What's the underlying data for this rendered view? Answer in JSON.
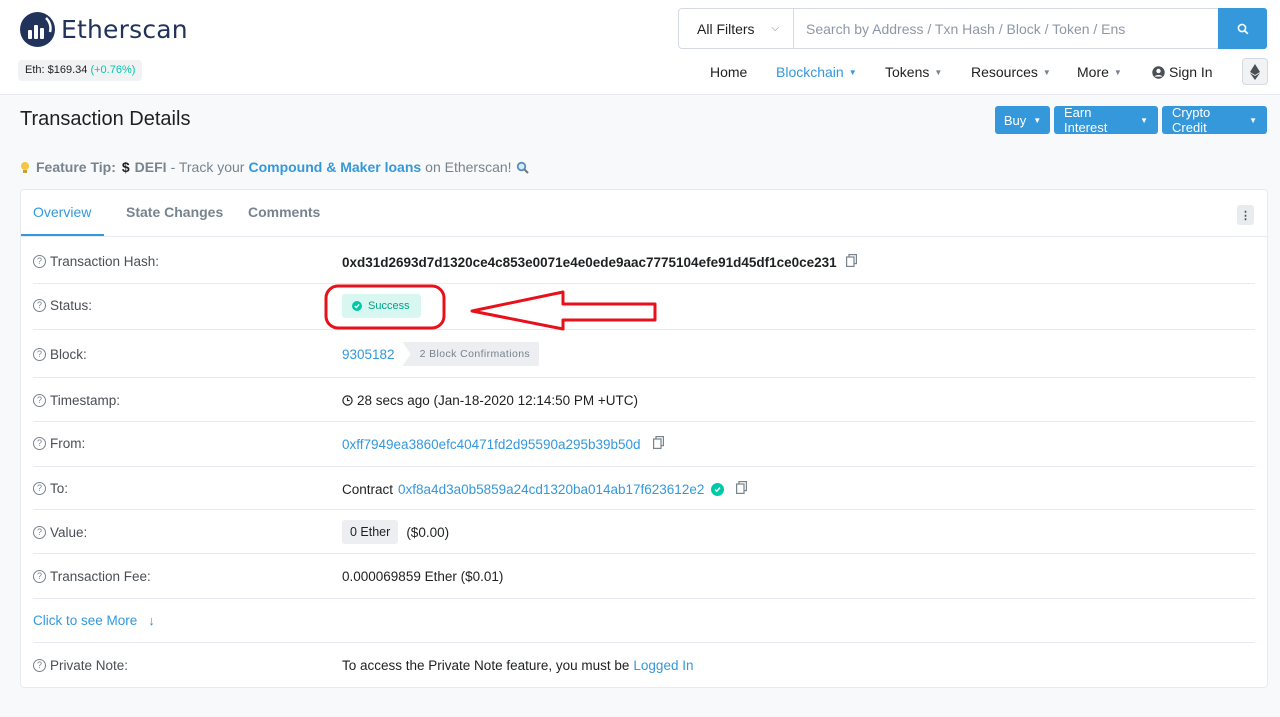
{
  "brand": {
    "name": "Etherscan"
  },
  "price": {
    "label": "Eth: $169.34",
    "change": "(+0.76%)"
  },
  "search": {
    "filter_label": "All Filters",
    "placeholder": "Search by Address / Txn Hash / Block / Token / Ens"
  },
  "nav": {
    "items": [
      "Home",
      "Blockchain",
      "Tokens",
      "Resources",
      "More"
    ],
    "sign_in": "Sign In"
  },
  "page": {
    "title": "Transaction Details"
  },
  "actions": {
    "buy": "Buy",
    "earn": "Earn Interest",
    "credit": "Crypto Credit"
  },
  "tip": {
    "label": "Feature Tip:",
    "defi": "DEFI",
    "pre": "- Track your",
    "link": "Compound & Maker loans",
    "post": "on Etherscan!"
  },
  "tabs": [
    "Overview",
    "State Changes",
    "Comments"
  ],
  "details": {
    "hash_label": "Transaction Hash:",
    "hash": "0xd31d2693d7d1320ce4c853e0071e4e0ede9aac7775104efe91d45df1ce0ce231",
    "status_label": "Status:",
    "status": "Success",
    "block_label": "Block:",
    "block": "9305182",
    "confirmations": "2 Block Confirmations",
    "timestamp_label": "Timestamp:",
    "timestamp": "28 secs ago (Jan-18-2020 12:14:50 PM +UTC)",
    "from_label": "From:",
    "from": "0xff7949ea3860efc40471fd2d95590a295b39b50d",
    "to_label": "To:",
    "to_prefix": "Contract",
    "to": "0xf8a4d3a0b5859a24cd1320ba014ab17f623612e2",
    "value_label": "Value:",
    "value": "0 Ether",
    "value_usd": "($0.00)",
    "fee_label": "Transaction Fee:",
    "fee": "0.000069859 Ether ($0.01)",
    "see_more": "Click to see More",
    "note_label": "Private Note:",
    "note_text": "To access the Private Note feature, you must be",
    "note_link": "Logged In"
  },
  "colors": {
    "accent": "#3498db",
    "success": "#00c9a7",
    "annotation": "#e8101a"
  }
}
